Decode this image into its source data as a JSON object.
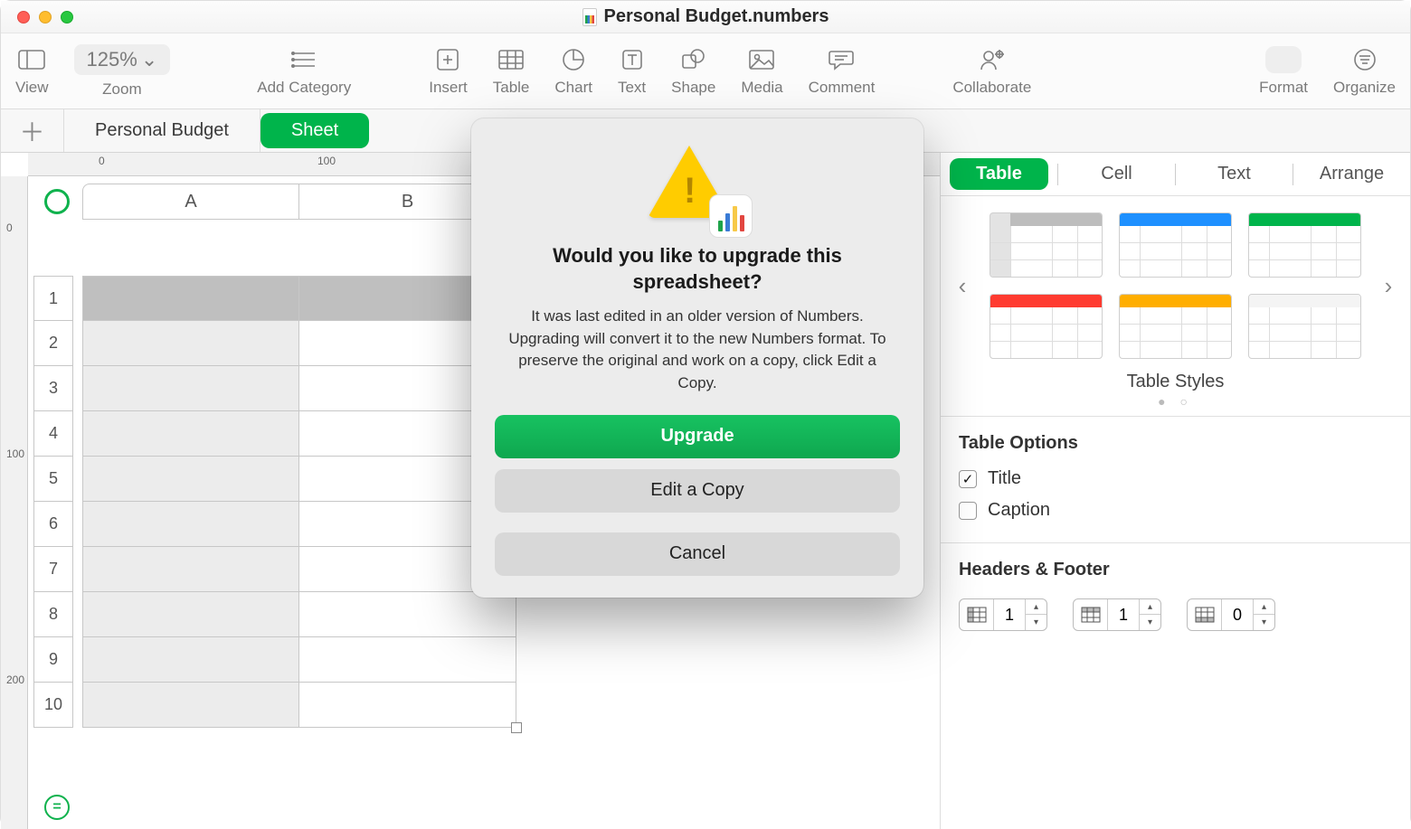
{
  "window": {
    "title": "Personal Budget.numbers"
  },
  "toolbar": {
    "view": "View",
    "zoom_label": "Zoom",
    "zoom_value": "125%",
    "add_category": "Add Category",
    "insert": "Insert",
    "table": "Table",
    "chart": "Chart",
    "text": "Text",
    "shape": "Shape",
    "media": "Media",
    "comment": "Comment",
    "collaborate": "Collaborate",
    "format": "Format",
    "organize": "Organize"
  },
  "tabs": {
    "sheet_name": "Personal Budget",
    "active_tab": "Sheet"
  },
  "ruler": {
    "h0": "0",
    "h1": "100",
    "v0": "0",
    "v1": "100",
    "v2": "200"
  },
  "columns": [
    "A",
    "B"
  ],
  "rows": [
    "1",
    "2",
    "3",
    "4",
    "5",
    "6",
    "7",
    "8",
    "9",
    "10"
  ],
  "inspector": {
    "tabs": {
      "table": "Table",
      "cell": "Cell",
      "text": "Text",
      "arrange": "Arrange"
    },
    "styles_label": "Table Styles",
    "options_title": "Table Options",
    "title_opt": "Title",
    "caption_opt": "Caption",
    "hf_title": "Headers & Footer",
    "hf": {
      "rows": "1",
      "cols": "1",
      "footer": "0"
    }
  },
  "dialog": {
    "heading": "Would you like to upgrade this spreadsheet?",
    "body": "It was last edited in an older version of Numbers. Upgrading will convert it to the new Numbers format. To preserve the original and work on a copy, click Edit a Copy.",
    "upgrade": "Upgrade",
    "edit_copy": "Edit a Copy",
    "cancel": "Cancel"
  }
}
